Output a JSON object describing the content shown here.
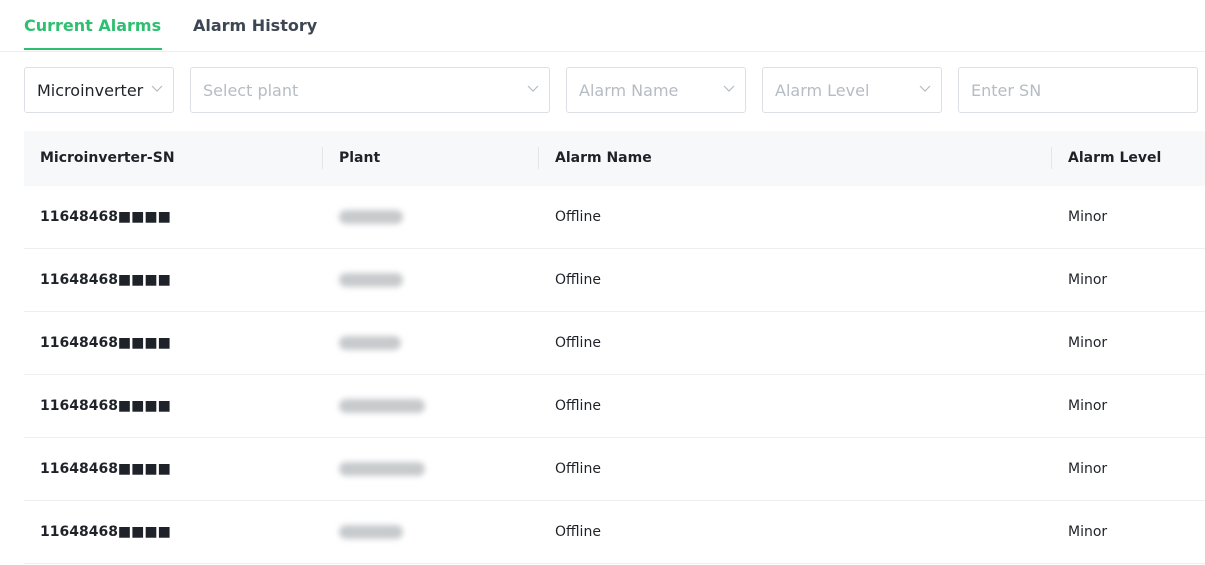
{
  "tabs": [
    {
      "label": "Current Alarms",
      "active": true
    },
    {
      "label": "Alarm History",
      "active": false
    }
  ],
  "colors": {
    "accent": "#2fbf71",
    "header_bg": "#f7f8f9"
  },
  "filters": {
    "device_type": {
      "value": "Microinverter"
    },
    "plant": {
      "placeholder": "Select plant"
    },
    "alarm_name": {
      "placeholder": "Alarm Name"
    },
    "alarm_level": {
      "placeholder": "Alarm Level"
    },
    "sn": {
      "placeholder": "Enter SN"
    }
  },
  "table": {
    "columns": [
      "Microinverter-SN",
      "Plant",
      "Alarm Name",
      "Alarm Level"
    ],
    "rows": [
      {
        "sn": "11648468■■■■",
        "plant": "",
        "alarm_name": "Offline",
        "alarm_level": "Minor"
      },
      {
        "sn": "11648468■■■■",
        "plant": "",
        "alarm_name": "Offline",
        "alarm_level": "Minor"
      },
      {
        "sn": "11648468■■■■",
        "plant": "",
        "alarm_name": "Offline",
        "alarm_level": "Minor"
      },
      {
        "sn": "11648468■■■■",
        "plant": "",
        "alarm_name": "Offline",
        "alarm_level": "Minor"
      },
      {
        "sn": "11648468■■■■",
        "plant": "",
        "alarm_name": "Offline",
        "alarm_level": "Minor"
      },
      {
        "sn": "11648468■■■■",
        "plant": "",
        "alarm_name": "Offline",
        "alarm_level": "Minor"
      }
    ]
  }
}
